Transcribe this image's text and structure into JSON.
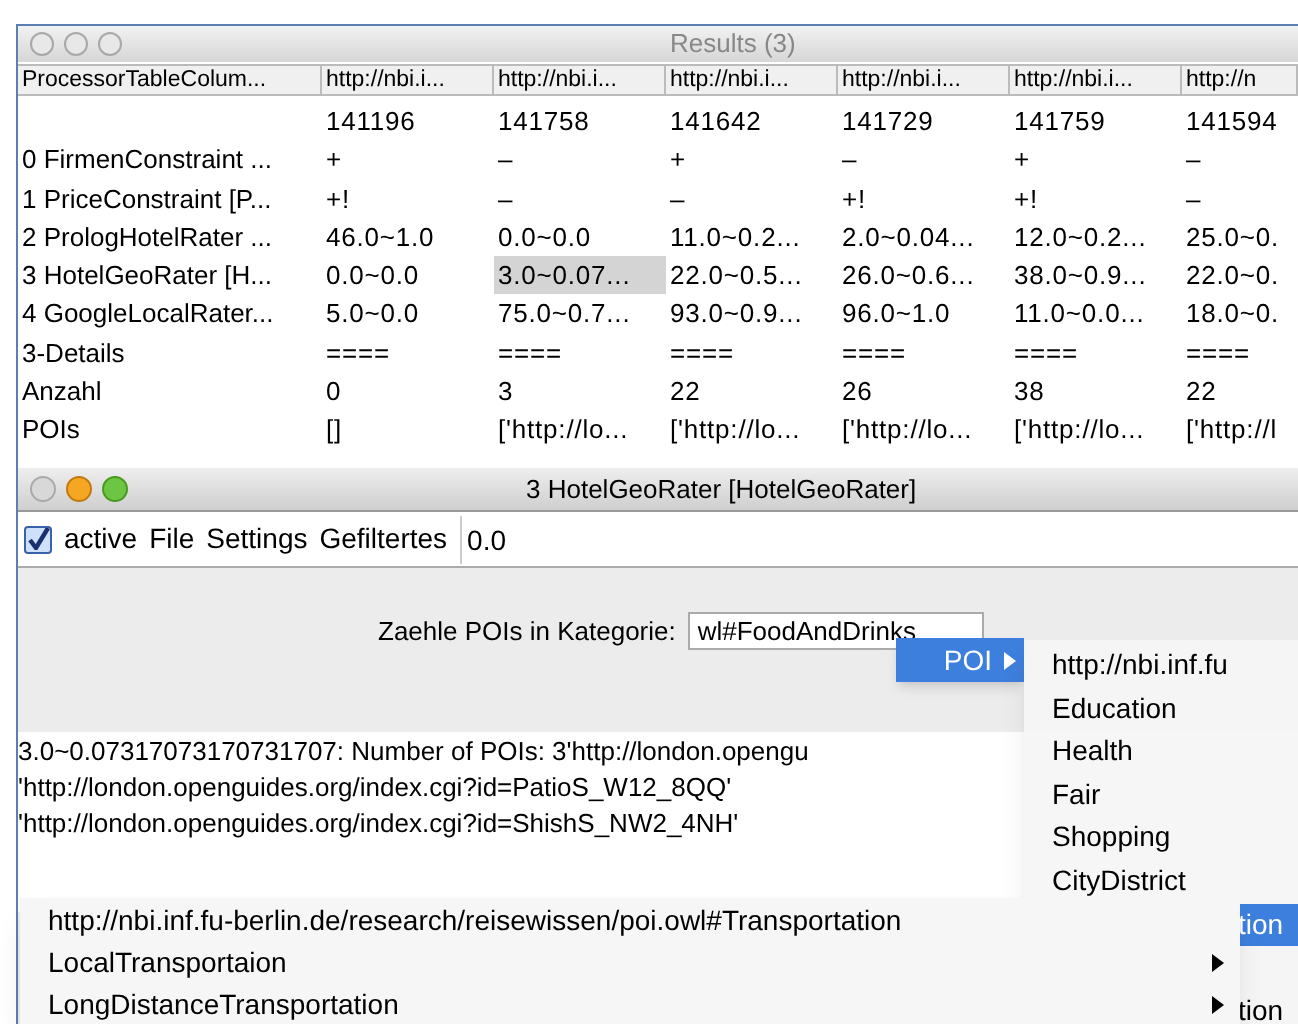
{
  "results_window": {
    "title": "Results (3)",
    "columns": [
      "ProcessorTableColum...",
      "http://nbi.i...",
      "http://nbi.i...",
      "http://nbi.i...",
      "http://nbi.i...",
      "http://nbi.i...",
      "http://n"
    ],
    "rows": [
      {
        "cells": [
          {
            "text": "",
            "selected": false
          },
          {
            "text": "141196",
            "selected": false
          },
          {
            "text": "141758",
            "selected": false
          },
          {
            "text": "141642",
            "selected": false
          },
          {
            "text": "141729",
            "selected": false
          },
          {
            "text": "141759",
            "selected": false
          },
          {
            "text": "141594",
            "selected": false
          }
        ]
      },
      {
        "cells": [
          {
            "text": "0 FirmenConstraint ...",
            "selected": false
          },
          {
            "text": "+",
            "selected": false
          },
          {
            "text": "–",
            "selected": false
          },
          {
            "text": "+",
            "selected": false
          },
          {
            "text": "–",
            "selected": false
          },
          {
            "text": "+",
            "selected": false
          },
          {
            "text": "–",
            "selected": false
          }
        ]
      },
      {
        "cells": [
          {
            "text": "1 PriceConstraint [P...",
            "selected": false
          },
          {
            "text": "+!",
            "selected": false
          },
          {
            "text": "–",
            "selected": false
          },
          {
            "text": "–",
            "selected": false
          },
          {
            "text": "+!",
            "selected": false
          },
          {
            "text": "+!",
            "selected": false
          },
          {
            "text": "–",
            "selected": false
          }
        ]
      },
      {
        "cells": [
          {
            "text": "2 PrologHotelRater ...",
            "selected": false
          },
          {
            "text": "46.0~1.0",
            "selected": false
          },
          {
            "text": "0.0~0.0",
            "selected": false
          },
          {
            "text": "11.0~0.2...",
            "selected": false
          },
          {
            "text": "2.0~0.04...",
            "selected": false
          },
          {
            "text": "12.0~0.2...",
            "selected": false
          },
          {
            "text": "25.0~0.",
            "selected": false
          }
        ]
      },
      {
        "cells": [
          {
            "text": "3 HotelGeoRater [H...",
            "selected": false
          },
          {
            "text": "0.0~0.0",
            "selected": false
          },
          {
            "text": "3.0~0.07...",
            "selected": true
          },
          {
            "text": "22.0~0.5...",
            "selected": false
          },
          {
            "text": "26.0~0.6...",
            "selected": false
          },
          {
            "text": "38.0~0.9...",
            "selected": false
          },
          {
            "text": "22.0~0.",
            "selected": false
          }
        ]
      },
      {
        "cells": [
          {
            "text": "4 GoogleLocalRater...",
            "selected": false
          },
          {
            "text": "5.0~0.0",
            "selected": false
          },
          {
            "text": "75.0~0.7...",
            "selected": false
          },
          {
            "text": "93.0~0.9...",
            "selected": false
          },
          {
            "text": "96.0~1.0",
            "selected": false
          },
          {
            "text": "11.0~0.0...",
            "selected": false
          },
          {
            "text": "18.0~0.",
            "selected": false
          }
        ]
      },
      {
        "cells": [
          {
            "text": "3-Details",
            "selected": false
          },
          {
            "text": "====",
            "selected": false
          },
          {
            "text": "====",
            "selected": false
          },
          {
            "text": "====",
            "selected": false
          },
          {
            "text": "====",
            "selected": false
          },
          {
            "text": "====",
            "selected": false
          },
          {
            "text": "====",
            "selected": false
          }
        ]
      },
      {
        "cells": [
          {
            "text": "Anzahl",
            "selected": false
          },
          {
            "text": "0",
            "selected": false
          },
          {
            "text": "3",
            "selected": false
          },
          {
            "text": "22",
            "selected": false
          },
          {
            "text": "26",
            "selected": false
          },
          {
            "text": "38",
            "selected": false
          },
          {
            "text": "22",
            "selected": false
          }
        ]
      },
      {
        "cells": [
          {
            "text": "POIs",
            "selected": false
          },
          {
            "text": "[]",
            "selected": false
          },
          {
            "text": "['http://lo...",
            "selected": false
          },
          {
            "text": "['http://lo...",
            "selected": false
          },
          {
            "text": "['http://lo...",
            "selected": false
          },
          {
            "text": "['http://lo...",
            "selected": false
          },
          {
            "text": "['http://l",
            "selected": false
          }
        ]
      }
    ]
  },
  "rater_window": {
    "title": "3 HotelGeoRater [HotelGeoRater]",
    "toolbar": {
      "active": {
        "label": "active",
        "checked": true
      },
      "menus": [
        "File",
        "Settings",
        "Gefiltertes"
      ],
      "value": "0.0"
    },
    "category_label": "Zaehle POIs in Kategorie:",
    "category_value": "wl#FoodAndDrinks",
    "output_lines": [
      "3.0~0.07317073170731707: Number of POIs: 3'http://london.opengu",
      "'http://london.openguides.org/index.cgi?id=PatioS_W12_8QQ'",
      "'http://london.openguides.org/index.cgi?id=ShishS_NW2_4NH'"
    ]
  },
  "menu": {
    "label": "POI",
    "selected": true,
    "has_submenu": true
  },
  "submenu": {
    "items": [
      {
        "label": "http://nbi.inf.fu",
        "selected": false
      },
      {
        "label": "Education",
        "selected": false
      },
      {
        "label": "Health",
        "selected": false
      },
      {
        "label": "Fair",
        "selected": false
      },
      {
        "label": "Shopping",
        "selected": false
      },
      {
        "label": "CityDistrict",
        "selected": false
      }
    ],
    "covered_items": [
      {
        "label": "tion",
        "selected": true
      },
      {
        "label": "tion",
        "selected": false
      }
    ]
  },
  "transport_menu": {
    "items": [
      {
        "label": "http://nbi.inf.fu-berlin.de/research/reisewissen/poi.owl#Transportation",
        "has_submenu": false
      },
      {
        "label": "LocalTransportaion",
        "has_submenu": true
      },
      {
        "label": "LongDistanceTransportation",
        "has_submenu": true
      }
    ]
  }
}
